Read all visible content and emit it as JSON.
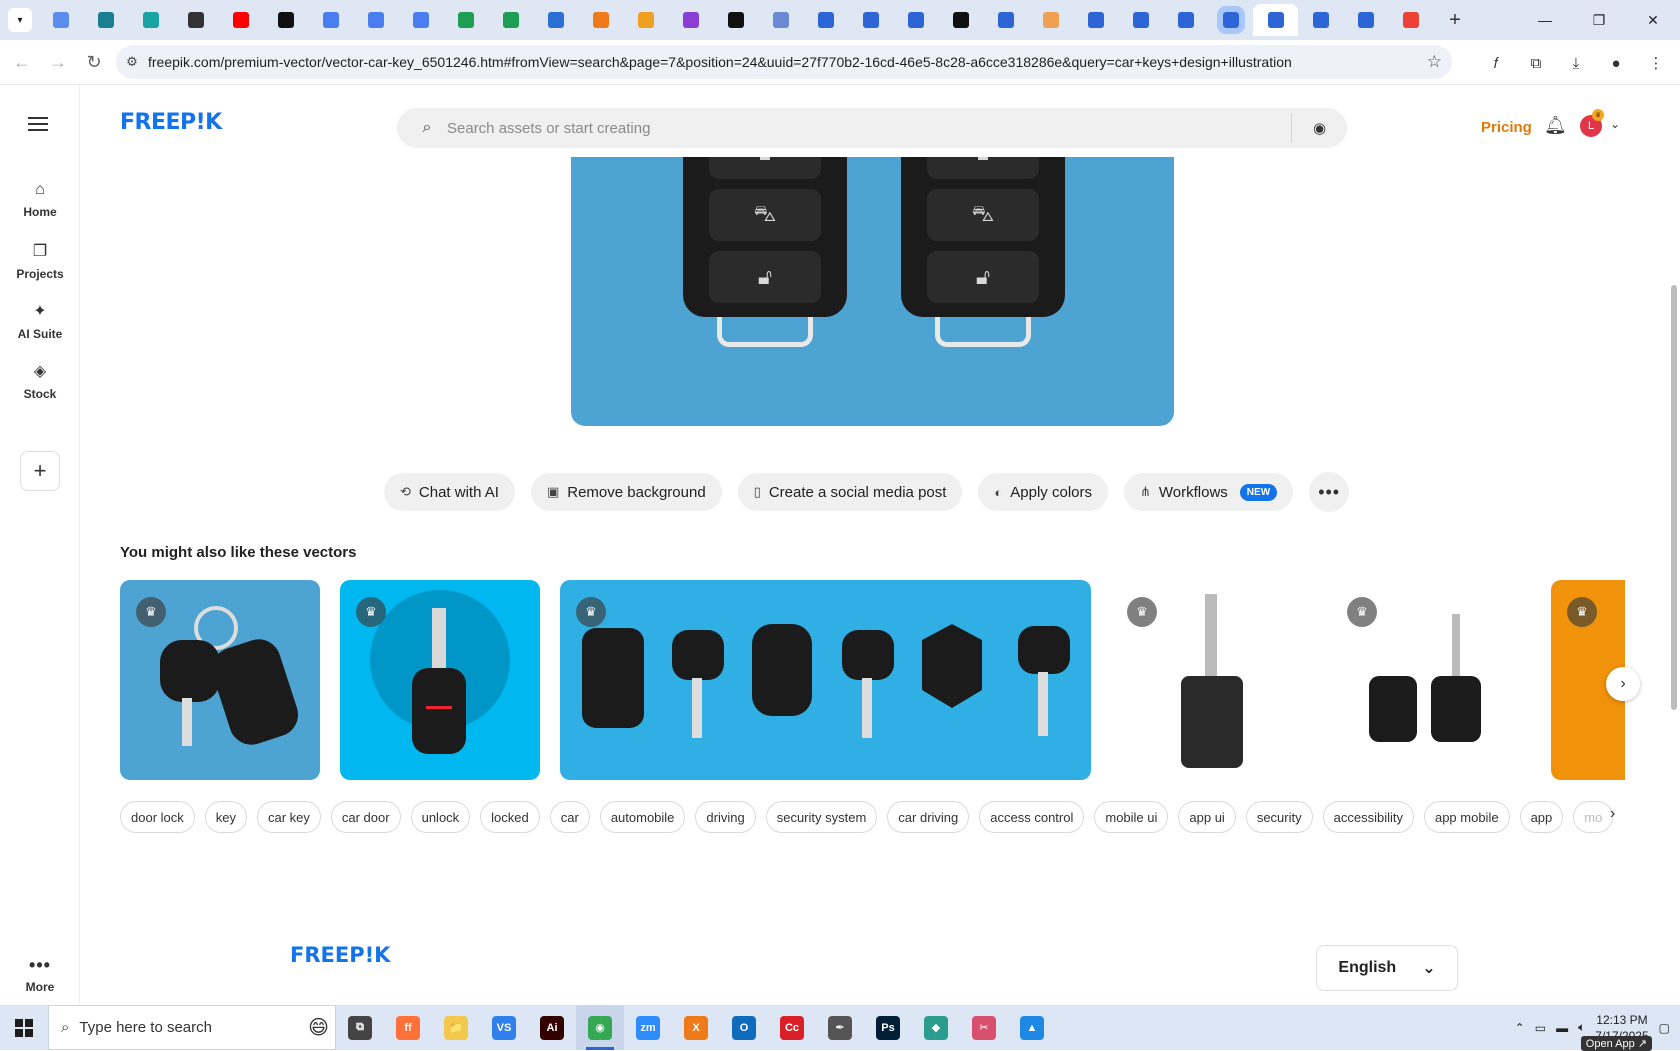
{
  "browser": {
    "url": "freepik.com/premium-vector/vector-car-key_6501246.htm#fromView=search&page=7&position=24&uuid=27f770b2-16cd-46e5-8c28-a6cce318286e&query=car+keys+design+illustration",
    "tab_favicons": [
      {
        "name": "tab-globe",
        "color": "#5b8def"
      },
      {
        "name": "tab-vpn",
        "color": "#1a7f8e"
      },
      {
        "name": "tab-arrow",
        "color": "#1aa3a3"
      },
      {
        "name": "tab-openai",
        "color": "#333333"
      },
      {
        "name": "tab-youtube",
        "color": "#ff0000"
      },
      {
        "name": "tab-bolt",
        "color": "#111111"
      },
      {
        "name": "tab-docs-1",
        "color": "#4a7df0"
      },
      {
        "name": "tab-docs-2",
        "color": "#4a7df0"
      },
      {
        "name": "tab-docs-3",
        "color": "#4a7df0"
      },
      {
        "name": "tab-sheets-1",
        "color": "#1e9e54"
      },
      {
        "name": "tab-sheets-2",
        "color": "#1e9e54"
      },
      {
        "name": "tab-word",
        "color": "#2b6fd6"
      },
      {
        "name": "tab-xampp",
        "color": "#f07a1a"
      },
      {
        "name": "tab-v",
        "color": "#f0a020"
      },
      {
        "name": "tab-brackets",
        "color": "#8a3ed6"
      },
      {
        "name": "tab-bracket-dark",
        "color": "#111111"
      },
      {
        "name": "tab-grid",
        "color": "#6a8ad6"
      },
      {
        "name": "tab-forms-1",
        "color": "#2d64d6"
      },
      {
        "name": "tab-forms-2",
        "color": "#2d64d6"
      },
      {
        "name": "tab-forms-3",
        "color": "#2d64d6"
      },
      {
        "name": "tab-m",
        "color": "#111111"
      },
      {
        "name": "tab-forms-4",
        "color": "#2d64d6"
      },
      {
        "name": "tab-hand",
        "color": "#f0a050"
      },
      {
        "name": "tab-forms-5",
        "color": "#2d64d6"
      },
      {
        "name": "tab-forms-6",
        "color": "#2d64d6"
      },
      {
        "name": "tab-forms-7",
        "color": "#2d64d6"
      },
      {
        "name": "tab-forms-8",
        "color": "#2d64d6"
      },
      {
        "name": "tab-forms-active",
        "color": "#2d64d6"
      },
      {
        "name": "tab-forms-9",
        "color": "#2d64d6"
      },
      {
        "name": "tab-forms-10",
        "color": "#2d64d6"
      },
      {
        "name": "tab-google",
        "color": "#ea4335"
      }
    ]
  },
  "header": {
    "logo": "FREEP!K",
    "search_placeholder": "Search assets or start creating",
    "pricing": "Pricing",
    "avatar_initial": "L"
  },
  "sidebar": {
    "items": [
      {
        "label": "Home",
        "icon": "home-icon",
        "glyph": "⌂"
      },
      {
        "label": "Projects",
        "icon": "projects-icon",
        "glyph": "❐"
      },
      {
        "label": "AI Suite",
        "icon": "ai-suite-icon",
        "glyph": "✦"
      },
      {
        "label": "Stock",
        "icon": "stock-icon",
        "glyph": "◈"
      }
    ],
    "more_label": "More"
  },
  "actions": [
    {
      "label": "Chat with AI",
      "icon": "chat-icon",
      "glyph": "⟲"
    },
    {
      "label": "Remove background",
      "icon": "remove-bg-icon",
      "glyph": "▣"
    },
    {
      "label": "Create a social media post",
      "icon": "phone-icon",
      "glyph": "▯"
    },
    {
      "label": "Apply colors",
      "icon": "palette-icon",
      "glyph": "◐"
    },
    {
      "label": "Workflows",
      "icon": "workflow-icon",
      "glyph": "⋔",
      "badge": "NEW"
    }
  ],
  "related": {
    "title": "You might also like these vectors"
  },
  "tags": [
    "door lock",
    "key",
    "car key",
    "car door",
    "unlock",
    "locked",
    "car",
    "automobile",
    "driving",
    "security system",
    "car driving",
    "access control",
    "mobile ui",
    "app ui",
    "security",
    "accessibility",
    "app mobile",
    "app",
    "mo"
  ],
  "footer": {
    "logo": "FREEP!K",
    "language": "English"
  },
  "taskbar": {
    "search_placeholder": "Type here to search",
    "time": "12:13 PM",
    "date": "7/17/2025",
    "open_app": "Open App ↗",
    "apps": [
      {
        "name": "taskview",
        "label": "⧉",
        "color": "#444444"
      },
      {
        "name": "firefox",
        "label": "ff",
        "color": "#ff7139"
      },
      {
        "name": "explorer",
        "label": "📁",
        "color": "#f2c94c"
      },
      {
        "name": "vscode",
        "label": "VS",
        "color": "#2f80ed"
      },
      {
        "name": "illustrator",
        "label": "Ai",
        "color": "#330000"
      },
      {
        "name": "chrome",
        "label": "◉",
        "color": "#34a853",
        "active": true
      },
      {
        "name": "zoom",
        "label": "zm",
        "color": "#2d8cff"
      },
      {
        "name": "xampp",
        "label": "X",
        "color": "#f07a1a"
      },
      {
        "name": "outlook",
        "label": "O",
        "color": "#0f6cbd"
      },
      {
        "name": "creative-cloud",
        "label": "Cc",
        "color": "#da1f26"
      },
      {
        "name": "pen-tool",
        "label": "✒",
        "color": "#555555"
      },
      {
        "name": "photoshop",
        "label": "Ps",
        "color": "#001e36"
      },
      {
        "name": "app-diamond",
        "label": "◆",
        "color": "#2a9d8f"
      },
      {
        "name": "snip",
        "label": "✂",
        "color": "#d94f6e"
      },
      {
        "name": "app-photos",
        "label": "▲",
        "color": "#1e88e5"
      }
    ]
  }
}
